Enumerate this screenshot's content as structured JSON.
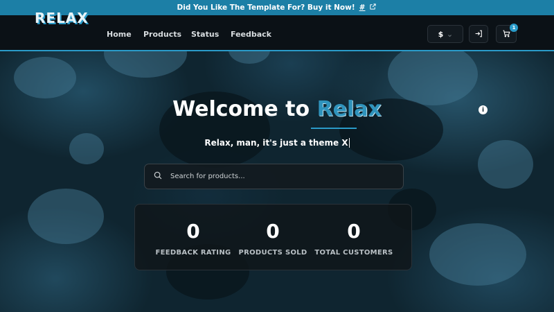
{
  "promo": {
    "text": "Did You Like The Template For? Buy it Now!",
    "hash": "#"
  },
  "navbar": {
    "logo": "RELAX",
    "links": [
      "Home",
      "Products",
      "Status",
      "Feedback"
    ],
    "currency": "$",
    "cart_count": "1"
  },
  "hero": {
    "title_prefix": "Welcome to ",
    "title_brand": "Relax",
    "subtitle": "Relax, man, it's just a theme X",
    "info_icon_text": "i"
  },
  "search": {
    "placeholder": "Search for products..."
  },
  "stats": [
    {
      "value": "0",
      "label": "FEEDBACK RATING"
    },
    {
      "value": "0",
      "label": "PRODUCTS SOLD"
    },
    {
      "value": "0",
      "label": "TOTAL CUSTOMERS"
    }
  ],
  "colors": {
    "accent": "#2a9bc9",
    "promo_bg": "#1c7fa6",
    "navbar_bg": "#0b1116"
  }
}
